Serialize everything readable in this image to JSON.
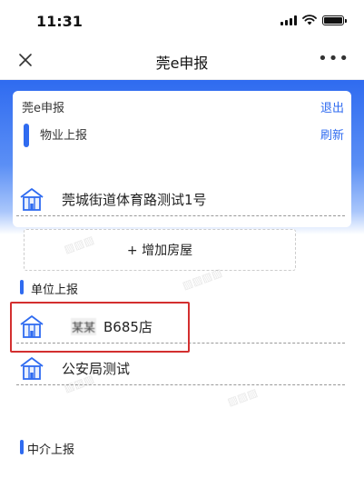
{
  "status_bar": {
    "time": "11:31"
  },
  "nav": {
    "title": "莞e申报"
  },
  "card": {
    "app_title": "莞e申报",
    "logout": "退出",
    "section_title": "物业上报",
    "refresh": "刷新"
  },
  "property_items": [
    {
      "label": "莞城街道体育路测试1号"
    }
  ],
  "add_house": "+ 增加房屋",
  "unit_section": {
    "title": "单位上报",
    "items": [
      {
        "masked": "某某",
        "label": "B685店"
      },
      {
        "label": "公安局测试"
      }
    ]
  },
  "agency_section": {
    "title": "中介上报"
  },
  "colors": {
    "accent": "#2f6bf0",
    "highlight": "#d32f2f"
  },
  "icons": [
    "close-icon",
    "more-icon",
    "building-icon",
    "signal-icon",
    "wifi-icon",
    "battery-icon"
  ]
}
